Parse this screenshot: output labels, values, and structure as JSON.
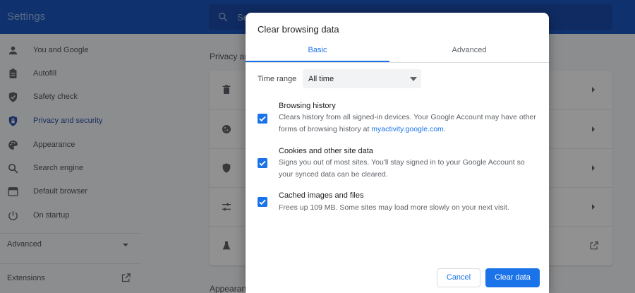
{
  "header": {
    "title": "Settings",
    "search_placeholder": "Search settings"
  },
  "sidebar": {
    "items": [
      {
        "label": "You and Google",
        "icon": "person-icon"
      },
      {
        "label": "Autofill",
        "icon": "clipboard-icon"
      },
      {
        "label": "Safety check",
        "icon": "shield-icon"
      },
      {
        "label": "Privacy and security",
        "icon": "shield-lock-icon",
        "active": true
      },
      {
        "label": "Appearance",
        "icon": "palette-icon"
      },
      {
        "label": "Search engine",
        "icon": "search-icon"
      },
      {
        "label": "Default browser",
        "icon": "browser-icon"
      },
      {
        "label": "On startup",
        "icon": "power-icon"
      }
    ],
    "advanced_label": "Advanced",
    "extensions_label": "Extensions"
  },
  "main": {
    "section_heading": "Privacy and security",
    "section_heading_2": "Appearance",
    "rows": [
      {
        "icon": "trash-icon"
      },
      {
        "icon": "cookie-icon"
      },
      {
        "icon": "shield-icon"
      },
      {
        "icon": "sliders-icon"
      },
      {
        "icon": "flask-icon"
      }
    ]
  },
  "dialog": {
    "title": "Clear browsing data",
    "tabs": {
      "basic": "Basic",
      "advanced": "Advanced"
    },
    "time_range_label": "Time range",
    "time_range_value": "All time",
    "options": [
      {
        "title": "Browsing history",
        "desc_before_link": "Clears history from all signed-in devices. Your Google Account may have other forms of browsing history at ",
        "link": "myactivity.google.com",
        "desc_after_link": ".",
        "checked": true
      },
      {
        "title": "Cookies and other site data",
        "desc": "Signs you out of most sites. You'll stay signed in to your Google Account so your synced data can be cleared.",
        "checked": true
      },
      {
        "title": "Cached images and files",
        "desc": "Frees up 109 MB. Some sites may load more slowly on your next visit.",
        "checked": true
      }
    ],
    "cancel_label": "Cancel",
    "clear_label": "Clear data"
  },
  "colors": {
    "header": "#1a56c0",
    "accent": "#1a73e8",
    "scrim": "rgba(0,0,0,0.42)"
  }
}
